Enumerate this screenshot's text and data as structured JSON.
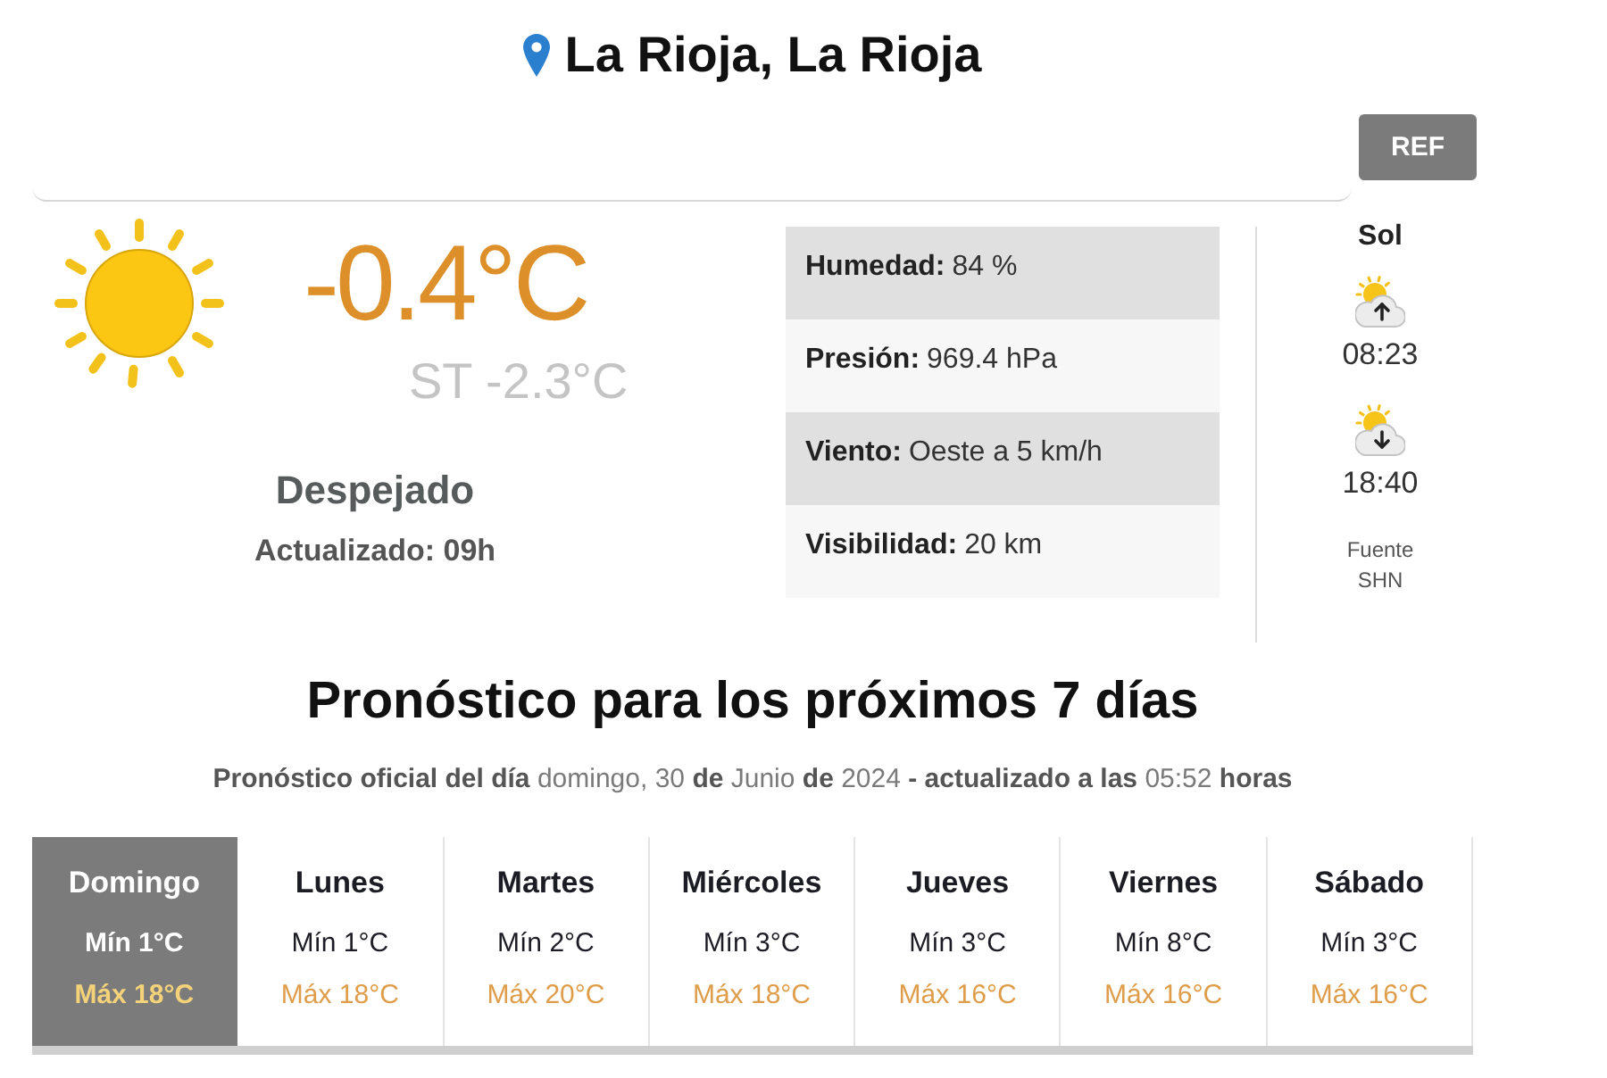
{
  "location": {
    "title": "La Rioja, La Rioja"
  },
  "ref_button": "REF",
  "current": {
    "temperature": "-0.4°C",
    "feels_like": "ST -2.3°C",
    "condition": "Despejado",
    "updated": "Actualizado: 09h"
  },
  "details": [
    {
      "label": "Humedad:",
      "value": "84 %"
    },
    {
      "label": "Presión:",
      "value": "969.4 hPa"
    },
    {
      "label": "Viento:",
      "value": "Oeste a 5 km/h"
    },
    {
      "label": "Visibilidad:",
      "value": "20 km"
    }
  ],
  "sun": {
    "title": "Sol",
    "events": [
      {
        "kind": "sunrise",
        "time": "08:23"
      },
      {
        "kind": "sunset",
        "time": "18:40"
      }
    ],
    "source_label": "Fuente",
    "source": "SHN"
  },
  "forecast": {
    "title": "Pronóstico para los próximos 7 días",
    "subtitle": "**Pronóstico oficial del día** domingo, 30 **de** Junio **de** 2024 **- actualizado a las** 05:52 **horas**",
    "days": [
      {
        "name": "Domingo",
        "min": "Mín 1°C",
        "max": "Máx 18°C",
        "selected": true
      },
      {
        "name": "Lunes",
        "min": "Mín 1°C",
        "max": "Máx 18°C",
        "selected": false
      },
      {
        "name": "Martes",
        "min": "Mín 2°C",
        "max": "Máx 20°C",
        "selected": false
      },
      {
        "name": "Miércoles",
        "min": "Mín 3°C",
        "max": "Máx 18°C",
        "selected": false
      },
      {
        "name": "Jueves",
        "min": "Mín 3°C",
        "max": "Máx 16°C",
        "selected": false
      },
      {
        "name": "Viernes",
        "min": "Mín 8°C",
        "max": "Máx 16°C",
        "selected": false
      },
      {
        "name": "Sábado",
        "min": "Mín 3°C",
        "max": "Máx 16°C",
        "selected": false
      }
    ]
  }
}
